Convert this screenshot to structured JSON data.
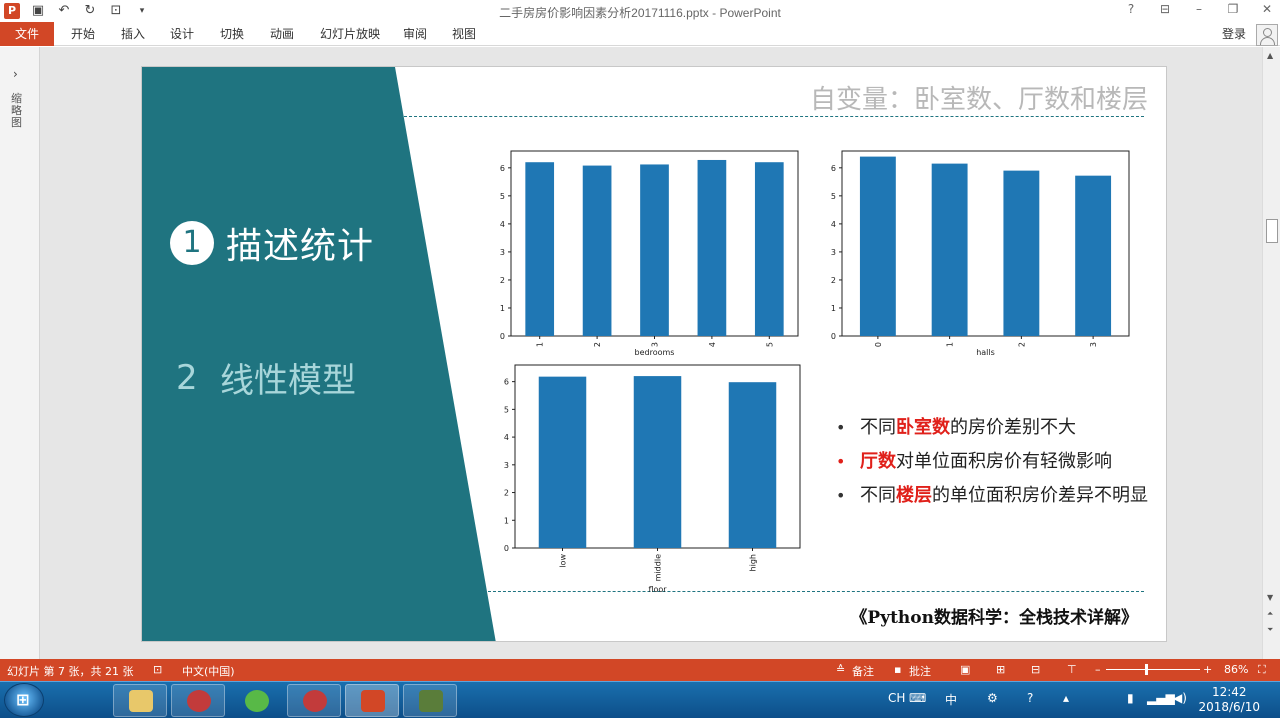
{
  "window": {
    "title": "二手房房价影响因素分析20171116.pptx - PowerPoint",
    "login": "登录"
  },
  "ribbon": {
    "tabs": [
      "文件",
      "开始",
      "插入",
      "设计",
      "切换",
      "动画",
      "幻灯片放映",
      "审阅",
      "视图"
    ]
  },
  "thumbnail_pane": {
    "label": "缩略图"
  },
  "slide": {
    "title": "自变量：卧室数、厅数和楼层",
    "sections": [
      {
        "number": "1",
        "label": "描述统计"
      },
      {
        "number": "2",
        "label": "线性模型"
      }
    ],
    "bullets": [
      {
        "before": "不同",
        "highlight": "卧室数",
        "after": "的房价差别不大",
        "dot": "gray"
      },
      {
        "before": "",
        "highlight": "厅数",
        "after": "对单位面积房价有轻微影响",
        "dot": "red"
      },
      {
        "before": "不同",
        "highlight": "楼层",
        "after": "的单位面积房价差异不明显",
        "dot": "gray"
      }
    ],
    "citation": "《Python数据科学：全栈技术详解》",
    "colors": {
      "teal": "#1f7480",
      "bar": "#1f77b4",
      "highlight": "#e0201a"
    }
  },
  "chart_data": [
    {
      "type": "bar",
      "categories": [
        "1",
        "2",
        "3",
        "4",
        "5"
      ],
      "values": [
        6.2,
        6.08,
        6.12,
        6.28,
        6.2
      ],
      "title": "",
      "xlabel": "bedrooms",
      "ylabel": "",
      "ylim": [
        0,
        6.6
      ],
      "yticks": [
        0,
        1,
        2,
        3,
        4,
        5,
        6
      ],
      "grid": false
    },
    {
      "type": "bar",
      "categories": [
        "0",
        "1",
        "2",
        "3"
      ],
      "values": [
        6.4,
        6.15,
        5.9,
        5.72
      ],
      "title": "",
      "xlabel": "halls",
      "ylabel": "",
      "ylim": [
        0,
        6.6
      ],
      "yticks": [
        0,
        1,
        2,
        3,
        4,
        5,
        6
      ],
      "grid": false
    },
    {
      "type": "bar",
      "categories": [
        "low",
        "middle",
        "high"
      ],
      "values": [
        6.18,
        6.2,
        5.98
      ],
      "title": "",
      "xlabel": "floor",
      "ylabel": "",
      "ylim": [
        0,
        6.6
      ],
      "yticks": [
        0,
        1,
        2,
        3,
        4,
        5,
        6
      ],
      "grid": false
    }
  ],
  "statusbar": {
    "slide_info": "幻灯片 第 7 张，共 21 张",
    "language": "中文(中国)",
    "notes": "备注",
    "comments": "批注",
    "zoom": "86%"
  },
  "taskbar": {
    "time": "12:42",
    "date": "2018/6/10",
    "ime": "CH"
  }
}
